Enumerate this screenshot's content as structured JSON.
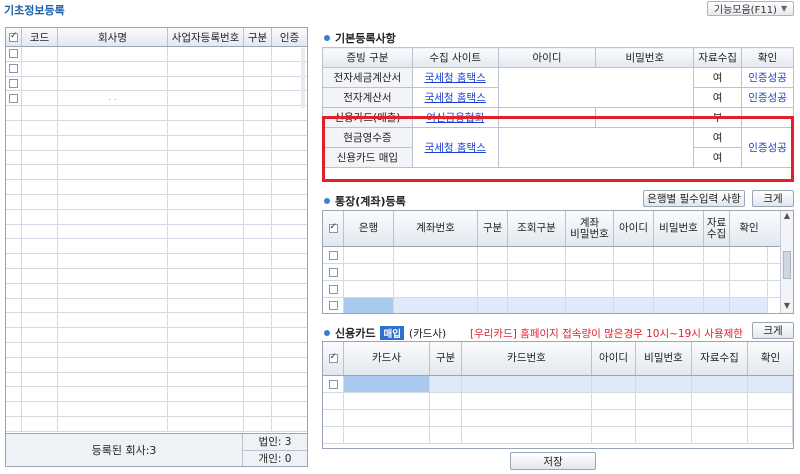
{
  "header": {
    "title": "기초정보등록",
    "func_button": "기능모음(F11)"
  },
  "company_grid": {
    "columns": [
      "코드",
      "회사명",
      "사업자등록번호",
      "구분",
      "인증"
    ],
    "faint_text": ". .",
    "footer_label": "등록된 회사:3",
    "corp_count": "법인:  3",
    "indiv_count": "개인:  0"
  },
  "basic": {
    "title": "기본등록사항",
    "columns": [
      "증빙 구분",
      "수집 사이트",
      "아이디",
      "비밀번호",
      "자료수집",
      "확인"
    ],
    "rows": [
      {
        "type": "전자세금계산서",
        "site": "국세청 홈택스",
        "collect": "여",
        "confirm": "인증성공"
      },
      {
        "type": "전자계산서",
        "site": "국세청 홈택스",
        "collect": "여",
        "confirm": "인증성공"
      },
      {
        "type": "신용카드(매출)",
        "site": "여신금융협회",
        "collect": "부",
        "confirm": ""
      },
      {
        "type": "현금영수증",
        "site": "국세청 홈택스",
        "collect": "여",
        "confirm": "인증성공"
      },
      {
        "type": "신용카드 매입",
        "site": "",
        "collect": "여",
        "confirm": ""
      }
    ]
  },
  "bank": {
    "title": "통장(계좌)등록",
    "required_button": "은행별 필수입력 사항",
    "expand_button": "크게",
    "columns": [
      "은행",
      "계좌번호",
      "구분",
      "조회구분",
      "계좌\n비밀번호",
      "아이디",
      "비밀번호",
      "자료\n수집",
      "확인"
    ]
  },
  "card": {
    "title": "신용카드",
    "badge": "매입",
    "subtitle": "(카드사)",
    "notice": "[우리카드] 홈페이지 접속량이 많은경우 10시~19시 사용제한",
    "expand_button": "크게",
    "columns": [
      "카드사",
      "구분",
      "카드번호",
      "아이디",
      "비밀번호",
      "자료수집",
      "확인"
    ]
  },
  "save_button": "저장",
  "colors": {
    "accent": "#3b7fd4",
    "link": "#1a3fd1",
    "highlight": "#e0202a",
    "notice": "#e0202a"
  }
}
